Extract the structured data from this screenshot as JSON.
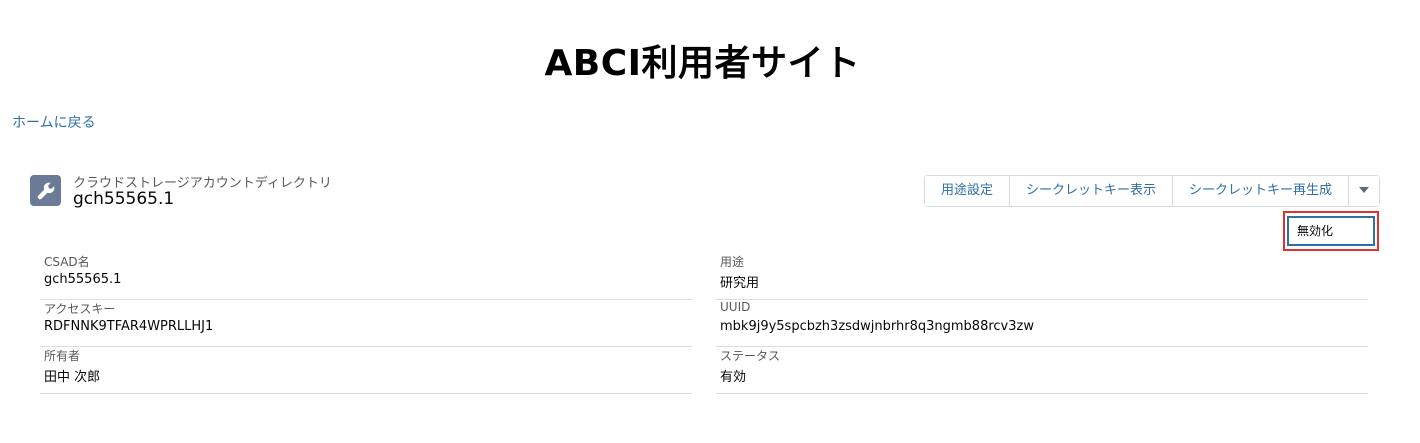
{
  "site": {
    "title": "ABCI利用者サイト",
    "home_link": "ホームに戻る"
  },
  "record": {
    "type_label": "クラウドストレージアカウントディレクトリ",
    "name": "gch55565.1",
    "icon": "wrench-icon",
    "icon_color": "#6b7b97"
  },
  "actions": {
    "buttons": [
      "用途設定",
      "シークレットキー表示",
      "シークレットキー再生成"
    ],
    "dropdown_icon": "chevron-down-icon",
    "dropdown_items": [
      "無効化"
    ],
    "link_color": "#2e6fa6",
    "highlight_color": "#e03232"
  },
  "fields": {
    "left": [
      {
        "label": "CSAD名",
        "value": "gch55565.1"
      },
      {
        "label": "アクセスキー",
        "value": "RDFNNK9TFAR4WPRLLHJ1"
      },
      {
        "label": "所有者",
        "value": "田中 次郎"
      }
    ],
    "right": [
      {
        "label": "用途",
        "value": "研究用"
      },
      {
        "label": "UUID",
        "value": "mbk9j9y5spcbzh3zsdwjnbrhr8q3ngmb88rcv3zw"
      },
      {
        "label": "ステータス",
        "value": "有効"
      }
    ]
  }
}
